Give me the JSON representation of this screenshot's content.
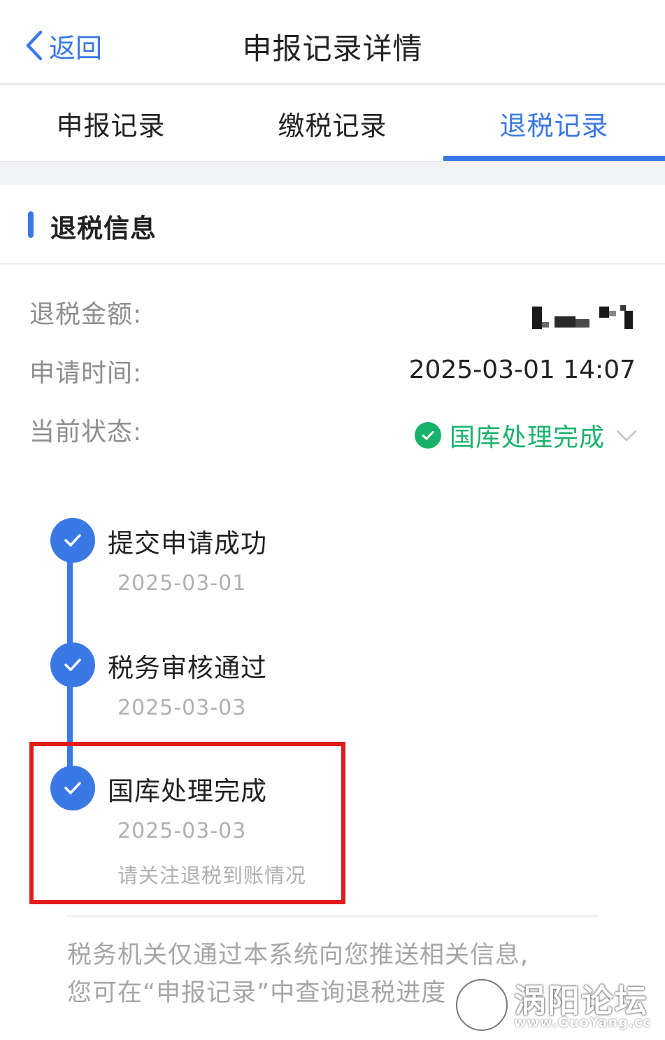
{
  "header": {
    "back_label": "返回",
    "title": "申报记录详情"
  },
  "tabs": [
    {
      "label": "申报记录",
      "active": false
    },
    {
      "label": "缴税记录",
      "active": false
    },
    {
      "label": "退税记录",
      "active": true
    }
  ],
  "section": {
    "title": "退税信息"
  },
  "info": {
    "amount_label": "退税金额:",
    "amount_value_masked": true,
    "apply_time_label": "申请时间:",
    "apply_time_value": "2025-03-01 14:07",
    "status_label": "当前状态:",
    "status_value": "国库处理完成"
  },
  "timeline": [
    {
      "title": "提交申请成功",
      "date": "2025-03-01",
      "note": ""
    },
    {
      "title": "税务审核通过",
      "date": "2025-03-03",
      "note": ""
    },
    {
      "title": "国库处理完成",
      "date": "2025-03-03",
      "note": "请关注退税到账情况"
    }
  ],
  "footnote": {
    "line1": "税务机关仅通过本系统向您推送相关信息,",
    "line2": "您可在“申报记录”中查询退税进度"
  },
  "watermark": {
    "name": "涡阳论坛",
    "url": "www.GuoYang.cc"
  },
  "colors": {
    "accent": "#3a78e6",
    "success": "#19b26b",
    "highlight_box": "#e21b1b",
    "muted_text": "#8e8e8e"
  }
}
